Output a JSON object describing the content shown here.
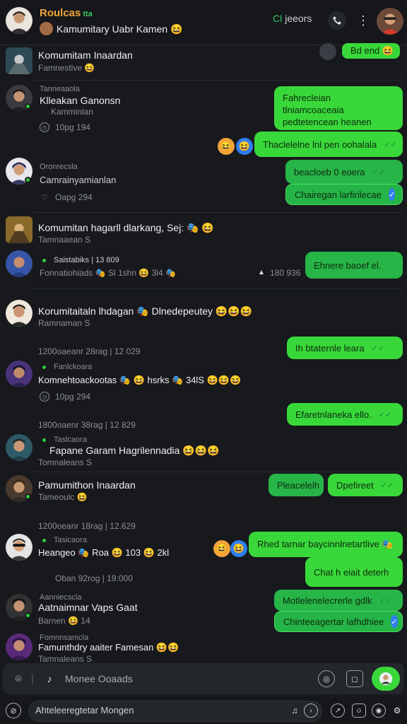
{
  "header": {
    "app_title": "Roulcas",
    "app_title_badge": "tta",
    "chat_title": "Kamumitary Uabr Kamen 😆",
    "search_prefix": "Cl",
    "search_label": "jeeors",
    "call_icon": "phone-icon",
    "menu_icon": "more-vertical-icon"
  },
  "rows": [
    {
      "name": "Komumitam Inaardan",
      "meta": "Famnestive 😆"
    },
    {
      "top": "Tanneaaola",
      "name": "Klleakan Ganonsn",
      "meta": "Kamminlan",
      "time": "10pg 194"
    },
    {
      "top": "Oronrecsla",
      "name": "Camrainyamianlan",
      "time": "Oapg 294"
    },
    {
      "name": "Komumitan hagarll dlarkang, Sej: 🎭 😆",
      "meta": "Tamnaaean S"
    },
    {
      "top": "Saistabiks | 13 809",
      "detail": "Fonnatiohiads 🎭 Sl 1shn 😆 3l4 🎭",
      "side": "180 936"
    },
    {
      "name": "Korumitaitaln lhdagan 🎭 Dlnedepeutey 😆😆😆",
      "meta": "Ramnaman S"
    },
    {
      "date": "1200oaeanr 28rag | 12 029",
      "top": "Fanlckoara",
      "name": "Komnehtoackootas 🎭 😆 hsrks 🎭 34lS 😆😆😆",
      "time": "10pg 294"
    },
    {
      "date": "1800oaenr 38rag | 12 829",
      "top": "Taslcaora",
      "name": "Fapane Garam Hagrilennadia 😆😆😆",
      "meta": "Tomnaleans S"
    },
    {
      "name": "Pamumithon Inaardan",
      "meta": "Tameoulc 😆"
    },
    {
      "date": "1200oeanr 18rag | 12.629",
      "top": "Tasicaora",
      "name": "Heangeo 🎭 Roa 😆 103 😆 2kl",
      "time": "Oban 92rog | 19:000"
    },
    {
      "top": "Aanniecscla",
      "name": "Aatnaimnar Vaps Gaat",
      "meta": "Barnen 😆 14"
    },
    {
      "top": "Fomnnsamcla",
      "name": "Famunthdry aaiter Famesan 😆😆",
      "meta": "Tamnaleans S"
    }
  ],
  "bubbles": [
    {
      "text": "Bd end 😆"
    },
    {
      "text": "Fahrecleian tlniamcoaceaia pedtetencean heanen"
    },
    {
      "text": "Thaclelelne lnl pen oohalala"
    },
    {
      "text": "beacloeb 0 eoera"
    },
    {
      "text": "Chairegan larfirilecae"
    },
    {
      "text": "Ehnere baoef el."
    },
    {
      "text": "Ih btaternle leara"
    },
    {
      "text": "Efaretnlaneka ello."
    },
    {
      "text": "Pleacelelh"
    },
    {
      "text": "Dpefireet"
    },
    {
      "text": "Rhed tarnar baycinnlnetartlive 🎭"
    },
    {
      "text": "Chat h eiait deterh"
    },
    {
      "text": "Motlelenelecrerle gdlk"
    },
    {
      "text": "Chinteeagertar lafhdhiee"
    }
  ],
  "input": {
    "placeholder": "Monee Ooaads"
  },
  "bottom": {
    "search": "Ahteleeregtetar Mongen"
  },
  "colors": {
    "bubble": "#39d83a",
    "accent": "#35c760",
    "bg": "#17191d",
    "title": "#f2a63a"
  }
}
